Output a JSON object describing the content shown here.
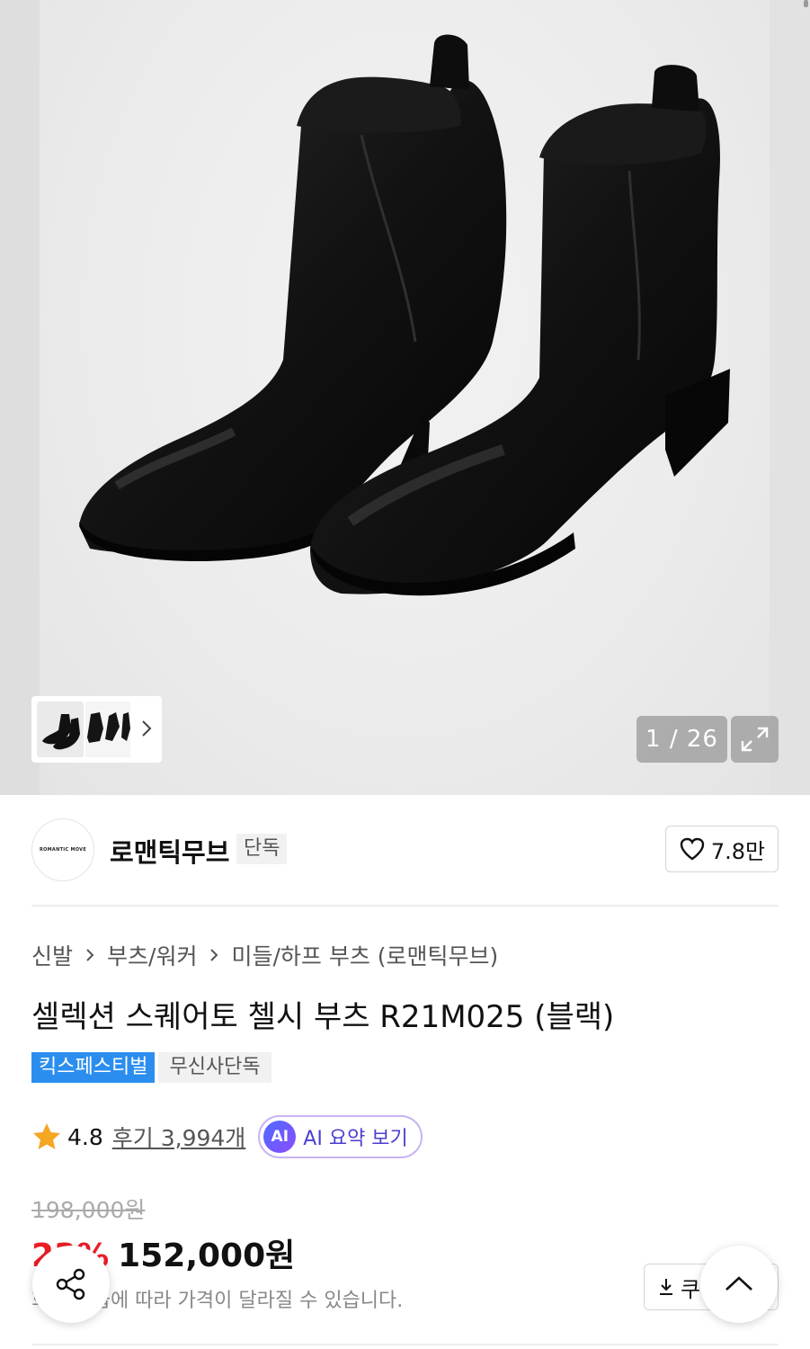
{
  "gallery": {
    "counter": "1 / 26",
    "thumbnail_alt": "product thumbnails"
  },
  "brand": {
    "logo_text": "ROMANTIC MOVE",
    "name": "로맨틱무브",
    "badge": "단독",
    "likes": "7.8만"
  },
  "product": {
    "breadcrumb": [
      "신발",
      "부츠/워커",
      "미들/하프 부츠 (로맨틱무브)"
    ],
    "title": "셀렉션 스퀘어토 첼시 부츠 R21M025 (블랙)",
    "tags": [
      "킥스페스티벌",
      "무신사단독"
    ],
    "rating": "4.8",
    "reviews": "후기 3,994개",
    "ai_icon": "AI",
    "ai_button": "AI 요약 보기",
    "original_price": "198,000원",
    "discount": "23%",
    "price": "152,000원",
    "price_note": "회원 등급에 따라 가격이 달라질 수 있습니다.",
    "coupon_label": "쿠"
  },
  "icons": {
    "heart": "heart-icon",
    "star": "star-icon",
    "share": "share-icon",
    "chevron_up": "chevron-up-icon",
    "expand": "expand-icon",
    "download": "download-icon"
  },
  "colors": {
    "discount_red": "#ee1c25",
    "tag_blue": "#2b8eef",
    "ai_purple": "#4a3fd1",
    "star_orange": "#f5a623"
  }
}
